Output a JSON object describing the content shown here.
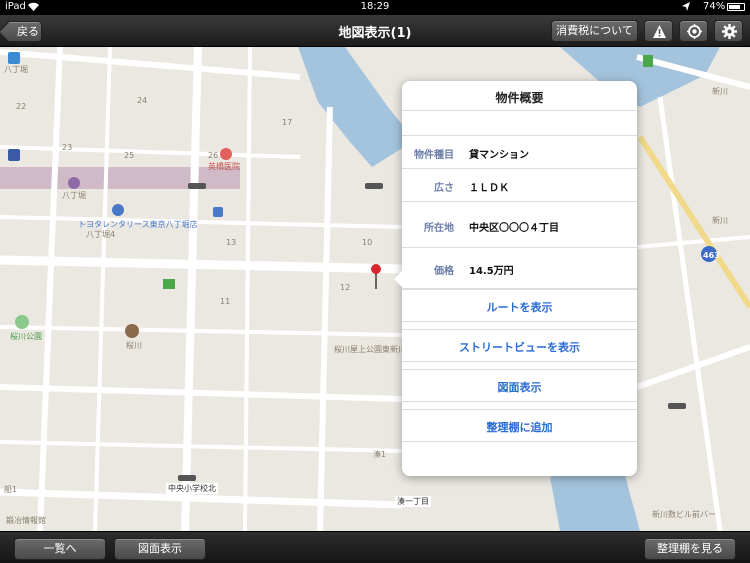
{
  "status_bar": {
    "device": "iPad",
    "time": "18:29",
    "battery": "74%"
  },
  "nav": {
    "back_label": "戻る",
    "title": "地図表示(1)",
    "tax_label": "消費税について"
  },
  "map": {
    "labels": {
      "hatchobori_top": "八丁堀",
      "n22": "22",
      "n24": "24",
      "n23": "23",
      "n25": "25",
      "n26": "26",
      "hospital": "英橋医院",
      "n17": "17",
      "hatchobori_st": "八丁堀",
      "rental": "トヨタレンタリース東京八丁堀店",
      "hatchobori4": "八丁堀4",
      "n13": "13",
      "n10": "10",
      "n12": "12",
      "n11": "11",
      "park": "桜川公園",
      "sakuragawa": "桜川",
      "school_label": "桜川屋上公園東新川",
      "minato1": "湊1",
      "chuo_school": "中央小学校北",
      "minato1_chome": "湊一丁目",
      "funa1": "船1",
      "info": "鍛冶情報館",
      "shinkawa": "新川",
      "shinkawa2": "新川",
      "route463": "463",
      "shinkawa_building": "新川数ビル前バー"
    }
  },
  "popover": {
    "title": "物件概要",
    "rows": [
      {
        "label": "物件種目",
        "value": "貸マンション"
      },
      {
        "label": "広さ",
        "value": "１ＬＤＫ"
      },
      {
        "label": "所在地",
        "value": "中央区〇〇〇４丁目"
      },
      {
        "label": "価格",
        "value": "14.5万円"
      }
    ],
    "actions": [
      {
        "label": "ルートを表示"
      },
      {
        "label": "ストリートビューを表示"
      },
      {
        "label": "図面表示"
      },
      {
        "label": "整理棚に追加"
      }
    ]
  },
  "toolbar": {
    "list_label": "一覧へ",
    "drawing_label": "図面表示",
    "shelf_label": "整理棚を見る"
  },
  "colors": {
    "accent": "#2a6bd1",
    "label": "#6b7ea8",
    "water": "#a4c4de",
    "road": "#ffffff",
    "rail": "#c9aec1"
  }
}
